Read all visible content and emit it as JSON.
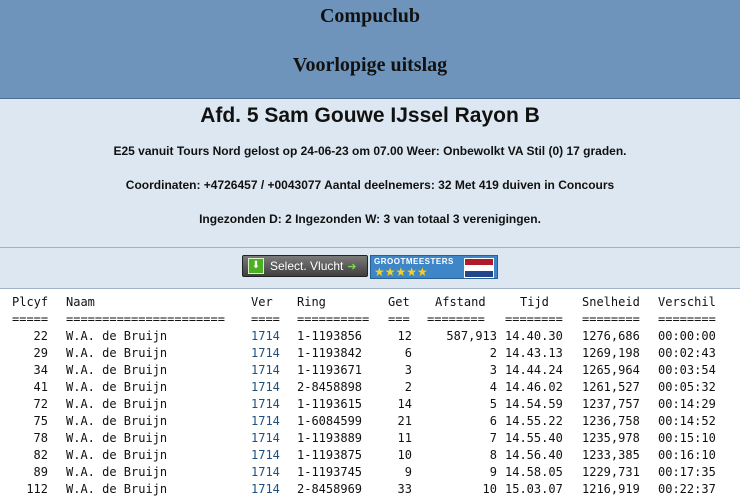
{
  "header": {
    "club": "Compuclub",
    "subtitle": "Voorlopige uitslag"
  },
  "info": {
    "afdeling": "Afd. 5 Sam Gouwe IJssel Rayon B",
    "line1": "E25 vanuit Tours Nord gelost op 24-06-23 om 07.00 Weer: Onbewolkt VA Stil (0) 17 graden.",
    "line2": "Coordinaten: +4726457 / +0043077 Aantal deelnemers: 32 Met 419 duiven in Concours",
    "line3": "Ingezonden D: 2 Ingezonden W: 3 van totaal 3 verenigingen."
  },
  "toolbar": {
    "select_label": "Select. Vlucht",
    "select_icon": "download-icon",
    "grootmeesters_text": "GROOTMEESTERS",
    "grootmeesters_stars": "★★★★★",
    "flag_colors": [
      "#ae1c28",
      "#ffffff",
      "#21468b"
    ]
  },
  "table": {
    "headers": {
      "plcyf": "Plcyf",
      "naam": "Naam",
      "ver": "Ver",
      "ring": "Ring",
      "get": "Get",
      "afstand": "Afstand",
      "tijd": "Tijd",
      "snelheid": "Snelheid",
      "verschil": "Verschil"
    },
    "separators": {
      "plcyf": "=====",
      "naam": "======================",
      "ver": "====",
      "ring": "==========",
      "get": "===",
      "afstand": "========",
      "tijd": "========",
      "snelheid": "========",
      "verschil": "========"
    },
    "rows": [
      {
        "plcyf": "22",
        "naam": "W.A. de Bruijn",
        "ver": "1714",
        "ring": "1-1193856",
        "get": "12",
        "afstand": "587,913",
        "tijd": "14.40.30",
        "snelheid": "1276,686",
        "verschil": "00:00:00"
      },
      {
        "plcyf": "29",
        "naam": "W.A. de Bruijn",
        "ver": "1714",
        "ring": "1-1193842",
        "get": "6",
        "afstand": "2",
        "tijd": "14.43.13",
        "snelheid": "1269,198",
        "verschil": "00:02:43"
      },
      {
        "plcyf": "34",
        "naam": "W.A. de Bruijn",
        "ver": "1714",
        "ring": "1-1193671",
        "get": "3",
        "afstand": "3",
        "tijd": "14.44.24",
        "snelheid": "1265,964",
        "verschil": "00:03:54"
      },
      {
        "plcyf": "41",
        "naam": "W.A. de Bruijn",
        "ver": "1714",
        "ring": "2-8458898",
        "get": "2",
        "afstand": "4",
        "tijd": "14.46.02",
        "snelheid": "1261,527",
        "verschil": "00:05:32"
      },
      {
        "plcyf": "72",
        "naam": "W.A. de Bruijn",
        "ver": "1714",
        "ring": "1-1193615",
        "get": "14",
        "afstand": "5",
        "tijd": "14.54.59",
        "snelheid": "1237,757",
        "verschil": "00:14:29"
      },
      {
        "plcyf": "75",
        "naam": "W.A. de Bruijn",
        "ver": "1714",
        "ring": "1-6084599",
        "get": "21",
        "afstand": "6",
        "tijd": "14.55.22",
        "snelheid": "1236,758",
        "verschil": "00:14:52"
      },
      {
        "plcyf": "78",
        "naam": "W.A. de Bruijn",
        "ver": "1714",
        "ring": "1-1193889",
        "get": "11",
        "afstand": "7",
        "tijd": "14.55.40",
        "snelheid": "1235,978",
        "verschil": "00:15:10"
      },
      {
        "plcyf": "82",
        "naam": "W.A. de Bruijn",
        "ver": "1714",
        "ring": "1-1193875",
        "get": "10",
        "afstand": "8",
        "tijd": "14.56.40",
        "snelheid": "1233,385",
        "verschil": "00:16:10"
      },
      {
        "plcyf": "89",
        "naam": "W.A. de Bruijn",
        "ver": "1714",
        "ring": "1-1193745",
        "get": "9",
        "afstand": "9",
        "tijd": "14.58.05",
        "snelheid": "1229,731",
        "verschil": "00:17:35"
      },
      {
        "plcyf": "112",
        "naam": "W.A. de Bruijn",
        "ver": "1714",
        "ring": "2-8458969",
        "get": "33",
        "afstand": "10",
        "tijd": "15.03.07",
        "snelheid": "1216,919",
        "verschil": "00:22:37"
      }
    ]
  }
}
